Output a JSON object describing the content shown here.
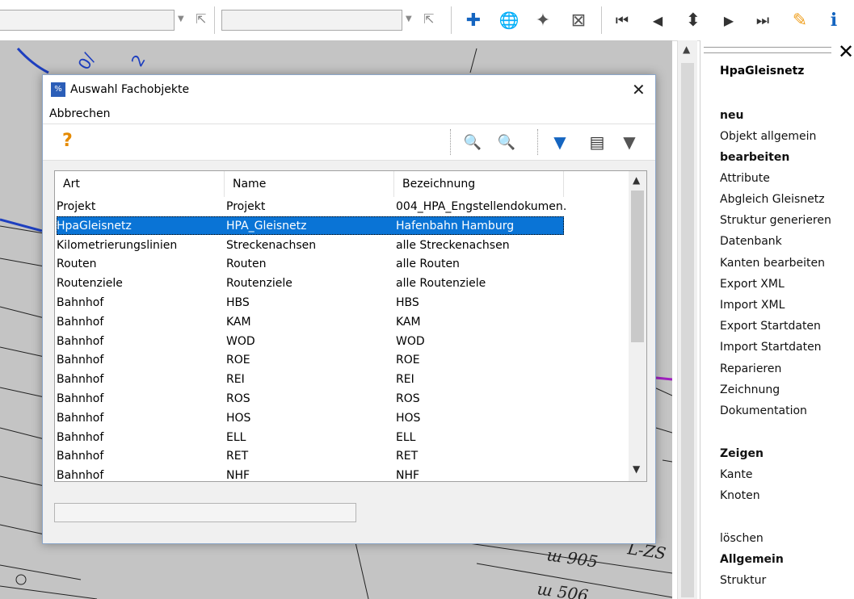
{
  "toolbar": {
    "combo1_value": "",
    "combo2_value": "",
    "icons": [
      "add-icon",
      "globe-icon",
      "pin-icon",
      "close-window-icon",
      "first-icon",
      "prev-icon",
      "updown-icon",
      "next-icon",
      "last-icon",
      "pencil-icon",
      "info-icon"
    ],
    "glyphs": {
      "add": "✚",
      "globe": "🌐",
      "pin": "✦",
      "closewin": "⊠",
      "first": "⏮",
      "prev": "◀",
      "updown": "⬍",
      "next": "▶",
      "last": "⏭",
      "pencil": "✎",
      "info": "i"
    }
  },
  "dialog": {
    "title": "Auswahl Fachobjekte",
    "app_icon": "%",
    "close": "✕",
    "menu": {
      "abbrechen": "Abbrechen"
    },
    "tools": {
      "help": "?",
      "zoom": "🔍",
      "zoom_next": "🔍",
      "filter_edit": "▼",
      "filter_table": "▤",
      "filter_reset": "▼"
    },
    "table": {
      "headers": [
        "Art",
        "Name",
        "Bezeichnung"
      ],
      "rows": [
        [
          "Projekt",
          "Projekt",
          "004_HPA_Engstellendokumen…"
        ],
        [
          "HpaGleisnetz",
          "HPA_Gleisnetz",
          "Hafenbahn Hamburg"
        ],
        [
          "Kilometrierungslinien",
          "Streckenachsen",
          "alle Streckenachsen"
        ],
        [
          "Routen",
          "Routen",
          "alle Routen"
        ],
        [
          "Routenziele",
          "Routenziele",
          "alle Routenziele"
        ],
        [
          "Bahnhof",
          "HBS",
          "HBS"
        ],
        [
          "Bahnhof",
          "KAM",
          "KAM"
        ],
        [
          "Bahnhof",
          "WOD",
          "WOD"
        ],
        [
          "Bahnhof",
          "ROE",
          "ROE"
        ],
        [
          "Bahnhof",
          "REI",
          "REI"
        ],
        [
          "Bahnhof",
          "ROS",
          "ROS"
        ],
        [
          "Bahnhof",
          "HOS",
          "HOS"
        ],
        [
          "Bahnhof",
          "ELL",
          "ELL"
        ],
        [
          "Bahnhof",
          "RET",
          "RET"
        ],
        [
          "Bahnhof",
          "NHF",
          "NHF"
        ]
      ],
      "selected_index": 1
    }
  },
  "panel": {
    "title": "HpaGleisnetz",
    "close": "✕",
    "items": [
      {
        "label": "neu",
        "bold": true
      },
      {
        "label": "Objekt allgemein",
        "bold": false
      },
      {
        "label": "bearbeiten",
        "bold": true
      },
      {
        "label": "Attribute",
        "bold": false
      },
      {
        "label": "Abgleich Gleisnetz",
        "bold": false
      },
      {
        "label": "Struktur generieren",
        "bold": false
      },
      {
        "label": "Datenbank",
        "bold": false
      },
      {
        "label": "Kanten bearbeiten",
        "bold": false
      },
      {
        "label": "Export XML",
        "bold": false
      },
      {
        "label": "Import XML",
        "bold": false
      },
      {
        "label": "Export Startdaten",
        "bold": false
      },
      {
        "label": "Import Startdaten",
        "bold": false
      },
      {
        "label": "Reparieren",
        "bold": false
      },
      {
        "label": "Zeichnung",
        "bold": false
      },
      {
        "label": "Dokumentation",
        "bold": false
      },
      {
        "label": "Zeigen",
        "bold": true
      },
      {
        "label": "Kante",
        "bold": false
      },
      {
        "label": "Knoten",
        "bold": false
      },
      {
        "label": "löschen",
        "bold": false
      },
      {
        "label": "Allgemein",
        "bold": true
      },
      {
        "label": "Struktur",
        "bold": false
      }
    ]
  },
  "map": {
    "labels": [
      "0/",
      "2",
      "ш 905",
      "ш 506",
      "L-ZS"
    ]
  },
  "colors": {
    "selection": "#0a74d6",
    "accent_blue": "#1565c0",
    "help_orange": "#e58a00",
    "pencil_orange": "#f0a020"
  }
}
